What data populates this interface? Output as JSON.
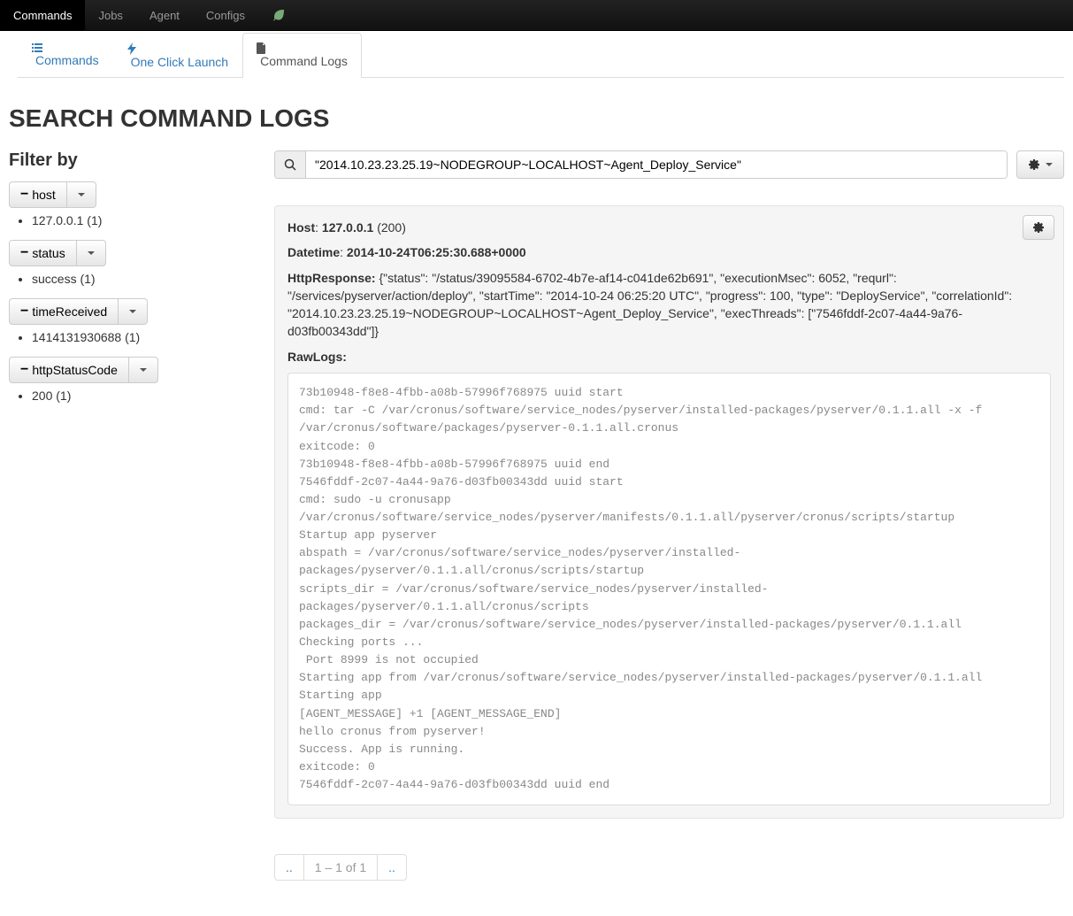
{
  "navbar": {
    "items": [
      {
        "label": "Commands",
        "active": true
      },
      {
        "label": "Jobs"
      },
      {
        "label": "Agent"
      },
      {
        "label": "Configs"
      }
    ]
  },
  "tabs": {
    "items": [
      {
        "label": "Commands",
        "icon": "list"
      },
      {
        "label": "One Click Launch",
        "icon": "bolt"
      },
      {
        "label": "Command Logs",
        "icon": "file",
        "active": true
      }
    ]
  },
  "page_title": "SEARCH COMMAND LOGS",
  "sidebar": {
    "heading": "Filter by",
    "filters": [
      {
        "name": "host",
        "items": [
          "127.0.0.1 (1)"
        ]
      },
      {
        "name": "status",
        "items": [
          "success (1)"
        ]
      },
      {
        "name": "timeReceived",
        "items": [
          "1414131930688 (1)"
        ]
      },
      {
        "name": "httpStatusCode",
        "items": [
          "200 (1)"
        ]
      }
    ]
  },
  "search": {
    "value": "\"2014.10.23.23.25.19~NODEGROUP~LOCALHOST~Agent_Deploy_Service\""
  },
  "result": {
    "host_label": "Host",
    "host_value": "127.0.0.1",
    "host_status": "(200)",
    "datetime_label": "Datetime",
    "datetime_value": "2014-10-24T06:25:30.688+0000",
    "httpresponse_label": "HttpResponse:",
    "httpresponse_value": "{\"status\": \"/status/39095584-6702-4b7e-af14-c041de62b691\", \"executionMsec\": 6052, \"requrl\": \"/services/pyserver/action/deploy\", \"startTime\": \"2014-10-24 06:25:20 UTC\", \"progress\": 100, \"type\": \"DeployService\", \"correlationId\": \"2014.10.23.23.25.19~NODEGROUP~LOCALHOST~Agent_Deploy_Service\", \"execThreads\": [\"7546fddf-2c07-4a44-9a76-d03fb00343dd\"]}",
    "rawlogs_label": "RawLogs:",
    "rawlogs": "73b10948-f8e8-4fbb-a08b-57996f768975 uuid start\ncmd: tar -C /var/cronus/software/service_nodes/pyserver/installed-packages/pyserver/0.1.1.all -x -f /var/cronus/software/packages/pyserver-0.1.1.all.cronus\nexitcode: 0\n73b10948-f8e8-4fbb-a08b-57996f768975 uuid end\n7546fddf-2c07-4a44-9a76-d03fb00343dd uuid start\ncmd: sudo -u cronusapp /var/cronus/software/service_nodes/pyserver/manifests/0.1.1.all/pyserver/cronus/scripts/startup\nStartup app pyserver\nabspath = /var/cronus/software/service_nodes/pyserver/installed-packages/pyserver/0.1.1.all/cronus/scripts/startup\nscripts_dir = /var/cronus/software/service_nodes/pyserver/installed-packages/pyserver/0.1.1.all/cronus/scripts\npackages_dir = /var/cronus/software/service_nodes/pyserver/installed-packages/pyserver/0.1.1.all\nChecking ports ...\n Port 8999 is not occupied\nStarting app from /var/cronus/software/service_nodes/pyserver/installed-packages/pyserver/0.1.1.all\nStarting app\n[AGENT_MESSAGE] +1 [AGENT_MESSAGE_END]\nhello cronus from pyserver!\nSuccess. App is running.\nexitcode: 0\n7546fddf-2c07-4a44-9a76-d03fb00343dd uuid end"
  },
  "pagination": {
    "prev": "..",
    "label": "1 – 1 of 1",
    "next": ".."
  }
}
